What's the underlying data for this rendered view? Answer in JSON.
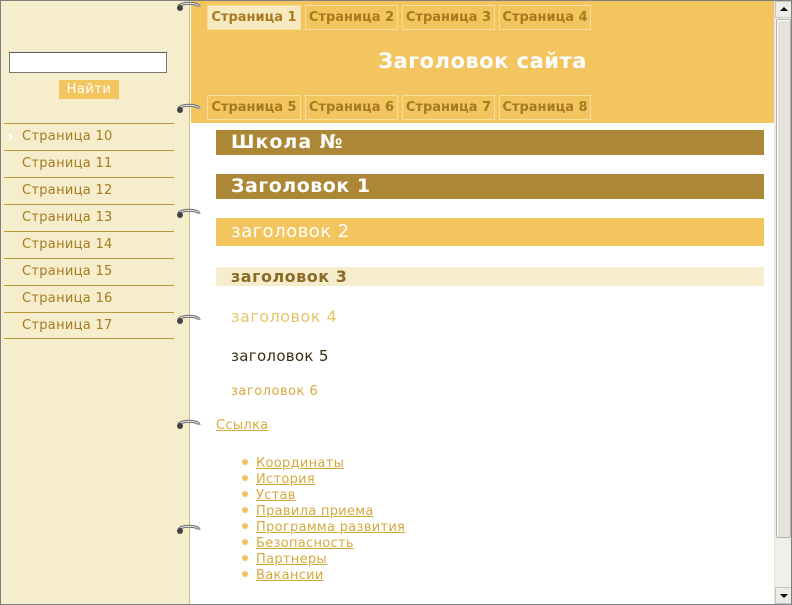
{
  "header": {
    "site_title": "Заголовок сайта",
    "tabs_top": [
      {
        "label": "Страница 1",
        "active": true
      },
      {
        "label": "Страница 2",
        "active": false
      },
      {
        "label": "Страница 3",
        "active": false
      },
      {
        "label": "Страница 4",
        "active": false
      }
    ],
    "tabs_bottom": [
      {
        "label": "Страница 5"
      },
      {
        "label": "Страница 6"
      },
      {
        "label": "Страница 7"
      },
      {
        "label": "Страница 8"
      }
    ]
  },
  "sidebar": {
    "search_value": "",
    "search_button": "Найти",
    "items": [
      {
        "label": "Страница 10",
        "active": true
      },
      {
        "label": "Страница 11"
      },
      {
        "label": "Страница 12"
      },
      {
        "label": "Страница 13"
      },
      {
        "label": "Страница 14"
      },
      {
        "label": "Страница 15"
      },
      {
        "label": "Страница 16"
      },
      {
        "label": "Страница 17"
      }
    ]
  },
  "content": {
    "school_heading": "Школа №",
    "h1": "Заголовок 1",
    "h2": "заголовок 2",
    "h3": "заголовок 3",
    "h4": "заголовок 4",
    "h5": "заголовок 5",
    "h6": "заголовок 6",
    "main_link": "Ссылка",
    "links": [
      "Координаты",
      "История",
      "Устав",
      "Правила приема",
      "Программа развития",
      "Безопасность",
      "Партнеры",
      "Вакансии"
    ]
  },
  "colors": {
    "accent": "#f2c55f",
    "dark_accent": "#ac8736",
    "sidebar_bg": "#f5edcb",
    "link": "#d6a83e"
  },
  "icons": {
    "ring": "notebook-ring-icon",
    "scroll_up": "arrow-up-icon",
    "scroll_down": "arrow-down-icon"
  }
}
